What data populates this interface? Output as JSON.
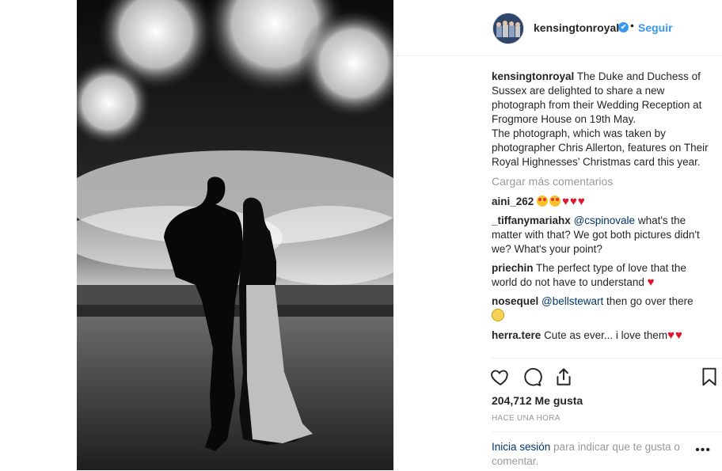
{
  "header": {
    "username": "kensingtonroyal",
    "verified_mark": "✔",
    "separator": "•",
    "follow_label": "Seguir"
  },
  "caption": {
    "username": "kensingtonroyal",
    "text": "The Duke and Duchess of Sussex are delighted to share a new photograph from their Wedding Reception at Frogmore House on 19th May.",
    "text2": "The photograph, which was taken by photographer Chris Allerton, features on Their Royal Highnesses’ Christmas card this year."
  },
  "load_more_label": "Cargar más comentarios",
  "comments": [
    {
      "username": "aini_262",
      "text": ""
    },
    {
      "username": "_tiffanymariahx",
      "mention": "@cspinovale",
      "text": " what's the matter with that? We got both pictures didn't we? What's your point?"
    },
    {
      "username": "priechin",
      "text": "The perfect type of love that the world do not have to understand "
    },
    {
      "username": "nosequel",
      "mention": "@bellstewart",
      "text": " then go over there"
    },
    {
      "username": "herra.tere",
      "text": "Cute as ever... i love them"
    }
  ],
  "likes_text": "204,712 Me gusta",
  "time_text": "HACE UNA HORA",
  "login": {
    "link_label": "Inicia sesión",
    "rest_text": " para indicar que te gusta o comentar.",
    "more_label": "•••"
  },
  "icons": [
    "heart-outline-icon",
    "comment-icon",
    "share-icon",
    "bookmark-icon"
  ],
  "colors": {
    "accent": "#3897f0",
    "link": "#003569",
    "muted": "#999999",
    "heart": "#e0142b"
  }
}
